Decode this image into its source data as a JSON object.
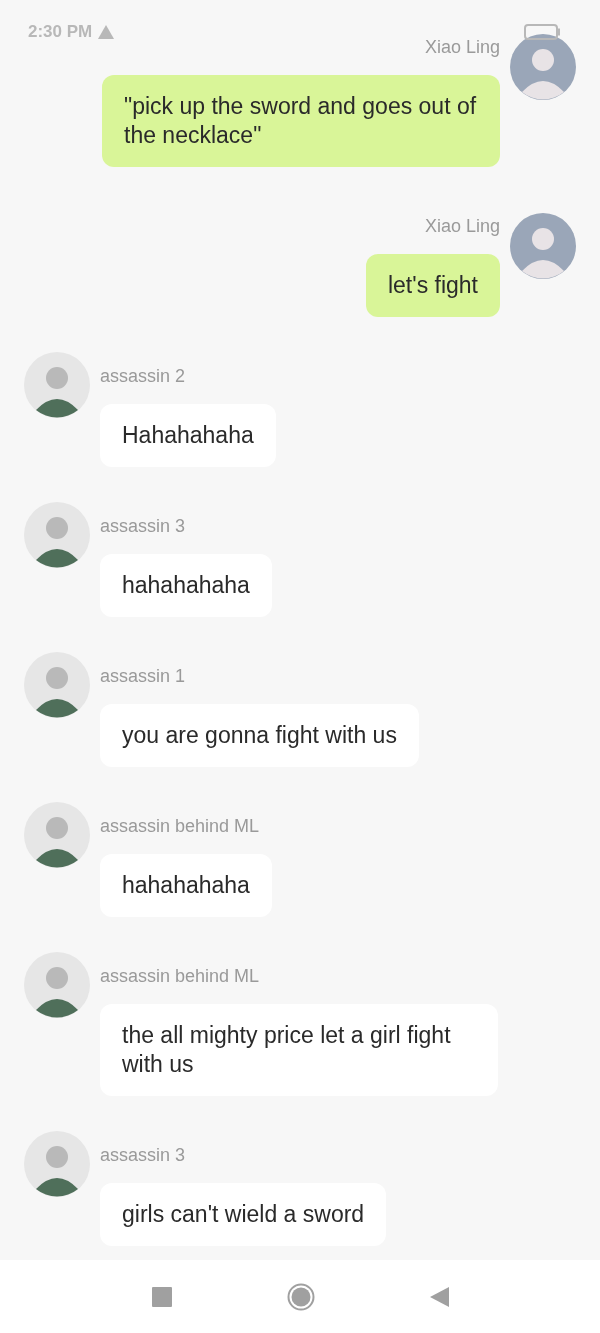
{
  "status_bar": {
    "time": "2:30 PM"
  },
  "messages": [
    {
      "kind": "outgoing",
      "sender": "Xiao Ling",
      "text": "\"pick up the sword and goes out of the necklace\""
    },
    {
      "kind": "outgoing",
      "sender": "Xiao Ling",
      "text": "let's fight"
    },
    {
      "kind": "incoming",
      "sender": "assassin 2",
      "text": "Hahahahaha"
    },
    {
      "kind": "incoming",
      "sender": "assassin 3",
      "text": "hahahahaha"
    },
    {
      "kind": "incoming",
      "sender": "assassin 1",
      "text": "you are gonna fight with us"
    },
    {
      "kind": "incoming",
      "sender": "assassin behind ML",
      "text": "hahahahaha"
    },
    {
      "kind": "incoming",
      "sender": "assassin behind ML",
      "text": "the all mighty price let a girl fight with us"
    },
    {
      "kind": "incoming",
      "sender": "assassin 3",
      "text": "girls can't wield a sword"
    }
  ]
}
